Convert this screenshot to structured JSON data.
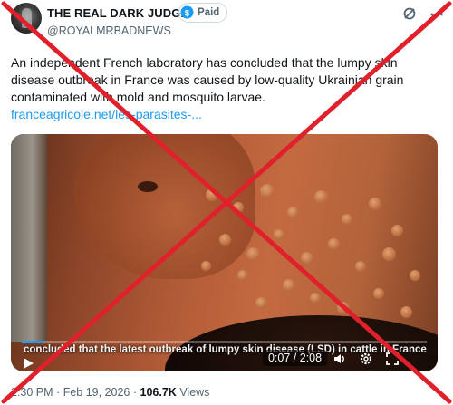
{
  "author": {
    "display_name": "THE REAL DARK JUDGE",
    "badge_label": "Paid",
    "handle": "@ROYALMRBADNEWS"
  },
  "tweet": {
    "text": "An independent French laboratory has concluded that the lumpy skin disease outbreak in France was caused by low-quality Ukrainian grain contaminated with mold and mosquito larvae.",
    "link_text": "franceagricole.net/les-parasites-..."
  },
  "video": {
    "caption": "concluded that the latest outbreak of lumpy skin disease (LSD) in cattle in France",
    "elapsed": "0:07",
    "duration": "2:08",
    "time_display": "0:07 / 2:08",
    "progress_fraction": 0.055
  },
  "footer": {
    "time": "2:30 PM",
    "separator": "·",
    "date": "Feb 19, 2026",
    "views_count": "106.7K",
    "views_label": "Views"
  },
  "colors": {
    "accent": "#1d9bf0",
    "muted_text": "#536471",
    "overlay_x": "#e0202a"
  },
  "icons": [
    "verified-coin-icon",
    "grok-icon",
    "more-icon",
    "play-icon",
    "volume-icon",
    "settings-icon",
    "fullscreen-icon"
  ]
}
